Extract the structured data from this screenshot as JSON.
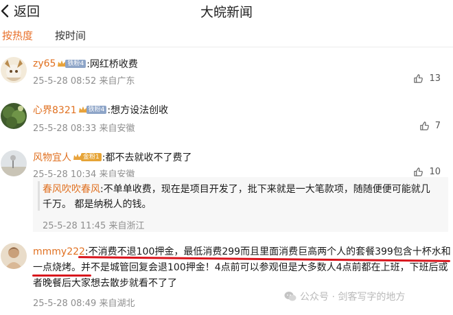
{
  "header": {
    "back_label": "返回",
    "title": "大皖新闻"
  },
  "sort": {
    "hot": "按热度",
    "time": "按时间"
  },
  "comments": [
    {
      "username": "zy65",
      "badge": "铁粉4",
      "text": ":网红桥收费",
      "timestamp": "25-5-28 08:52",
      "location": "来自广东",
      "likes": "13"
    },
    {
      "username": "心界8321",
      "badge": "铁粉4",
      "text": ":想方设法创收",
      "timestamp": "25-5-28 08:33",
      "location": "来自安徽",
      "likes": "7"
    },
    {
      "username": "风物宜人",
      "badge": "金粉1",
      "text": ":都不去就收不了费了",
      "timestamp": "25-5-28 10:34",
      "location": "来自安徽",
      "likes": "10"
    }
  ],
  "reply": {
    "username": "春风吹吹春风",
    "text": ":不单单收费，现在是项目开发了，批下来就是一大笔款项，随随便便可能就几千万。 都是纳税人的钱。",
    "timestamp": "25-5-28 11:45",
    "location": "来自浙江"
  },
  "long_comment": {
    "username": "mmmy222",
    "text": ":不消费不退100押金，最低消费299而且里面消费巨高两个人的套餐399包含十杯水和一点烧烤。并不是城管回复会退100押金！4点前可以参观但是大多数人4点前都在上班，下班后或者晚餐后大家想去散步就看不了了",
    "timestamp": "25-5-28 08:49",
    "location": "来自湖北"
  },
  "watermark": "公众号 · 剑客写字的地方",
  "colors": {
    "accent": "#e07020",
    "underline": "#d8141c"
  },
  "icons": {
    "back": "chevron-left-icon",
    "like": "thumbs-up-icon",
    "badge": "crown-icon",
    "watermark": "wechat-icon"
  }
}
